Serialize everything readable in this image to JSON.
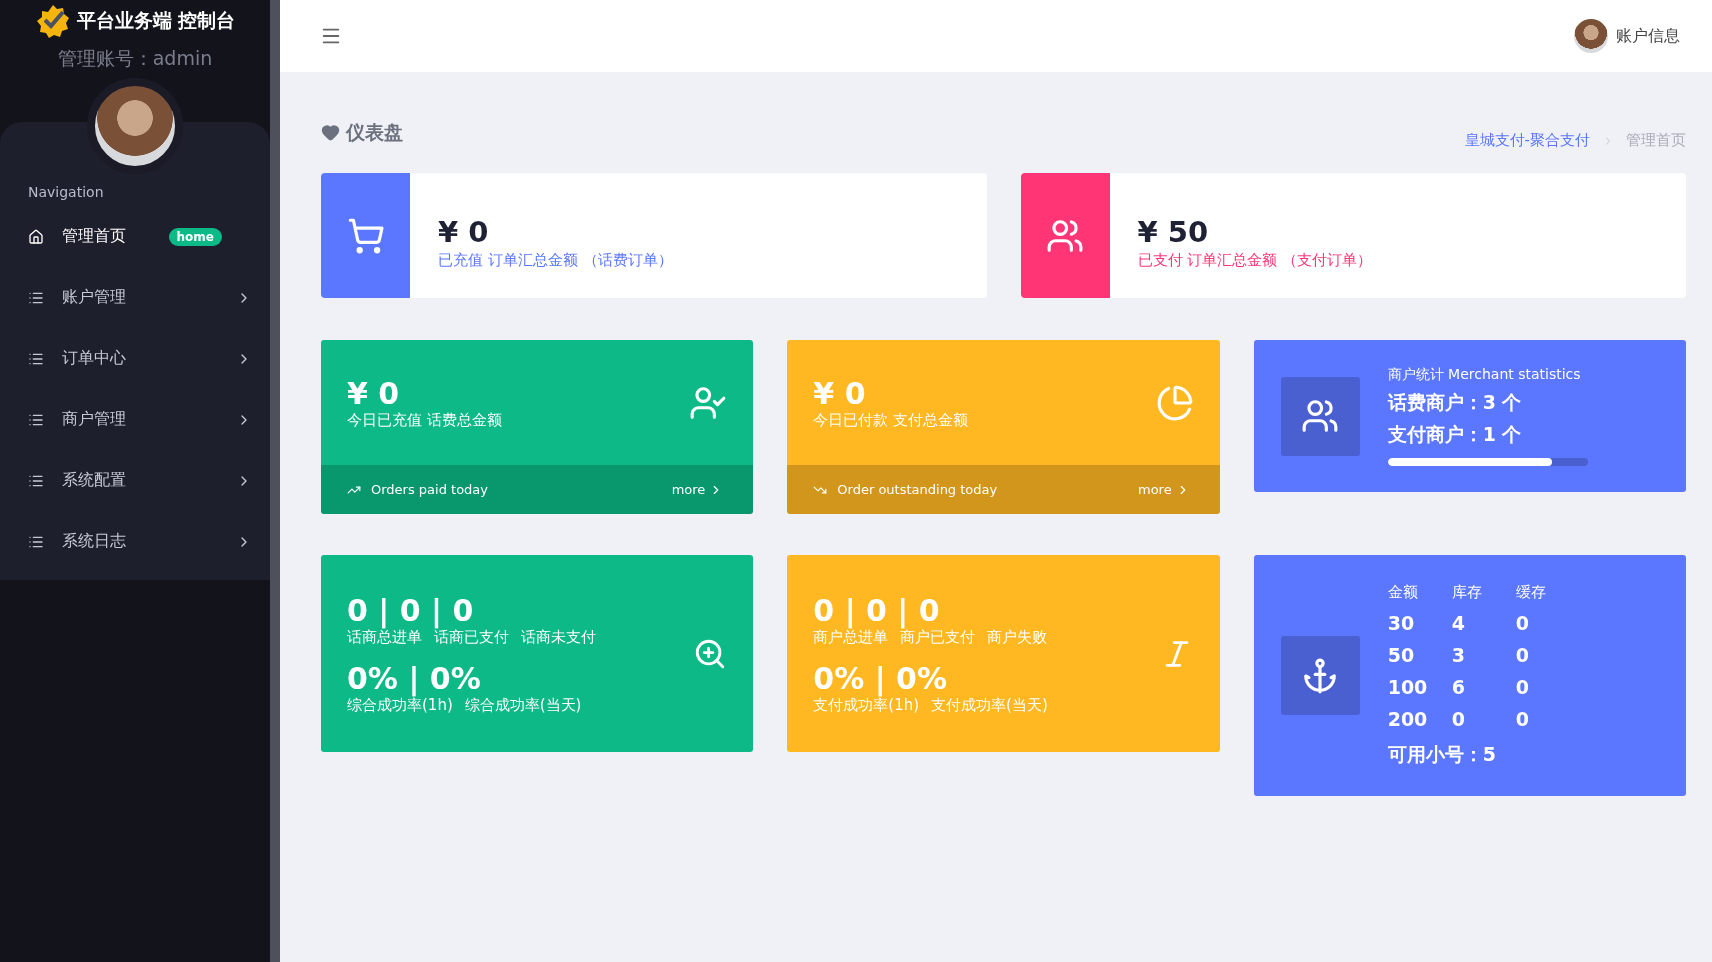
{
  "sidebar": {
    "brand": "平台业务端 控制台",
    "account": "管理账号：admin",
    "nav_heading": "Navigation",
    "items": [
      {
        "label": "管理首页",
        "kind": "home",
        "badge": "home",
        "selected": true
      },
      {
        "label": "账户管理",
        "kind": "list",
        "selected": false
      },
      {
        "label": "订单中心",
        "kind": "list",
        "selected": false
      },
      {
        "label": "商户管理",
        "kind": "list",
        "selected": false
      },
      {
        "label": "系统配置",
        "kind": "list",
        "selected": false
      },
      {
        "label": "系统日志",
        "kind": "list",
        "selected": false
      }
    ]
  },
  "topbar": {
    "account_label": "账户信息"
  },
  "page": {
    "title": "仪表盘",
    "breadcrumb": [
      {
        "label": "皇城支付-聚合支付",
        "selected": false
      },
      {
        "label": "管理首页",
        "selected": true
      }
    ]
  },
  "summary_cards": [
    {
      "amount": "¥ 0",
      "label": "已充值 订单汇总金额 （话费订单）",
      "color": "#5b76ff"
    },
    {
      "amount": "¥ 50",
      "label": "已支付 订单汇总金额 （支付订单）",
      "color": "#ff3576"
    }
  ],
  "stat_cards": [
    {
      "amount": "¥ 0",
      "label": "今日已充值 话费总金额",
      "footer": "Orders paid today",
      "more": "more",
      "color": "#0cb987"
    },
    {
      "amount": "¥ 0",
      "label": "今日已付款 支付总金额",
      "footer": "Order outstanding today",
      "more": "more",
      "color": "#ffb822"
    }
  ],
  "merchant": {
    "title": "商户统计 Merchant statistics",
    "lines": [
      "话费商户：3 个",
      "支付商户：1 个"
    ],
    "level": 0.82
  },
  "count_cards": [
    {
      "counts": "0 | 0 | 0",
      "count_labels": [
        "话商总进单",
        "话商已支付",
        "话商未支付"
      ],
      "rates": "0% | 0%",
      "rate_labels": [
        "综合成功率(1h)",
        "综合成功率(当天)"
      ],
      "color": "#0cb987"
    },
    {
      "counts": "0 | 0 | 0",
      "count_labels": [
        "商户总进单",
        "商户已支付",
        "商户失败"
      ],
      "rates": "0% | 0%",
      "rate_labels": [
        "支付成功率(1h)",
        "支付成功率(当天)"
      ],
      "color": "#ffb822"
    }
  ],
  "stock": {
    "columns": [
      "金额",
      "库存",
      "缓存"
    ],
    "rows": [
      [
        "30",
        "4",
        "0"
      ],
      [
        "50",
        "3",
        "0"
      ],
      [
        "100",
        "6",
        "0"
      ],
      [
        "200",
        "0",
        "0"
      ]
    ],
    "footer": "可用小号：5"
  }
}
